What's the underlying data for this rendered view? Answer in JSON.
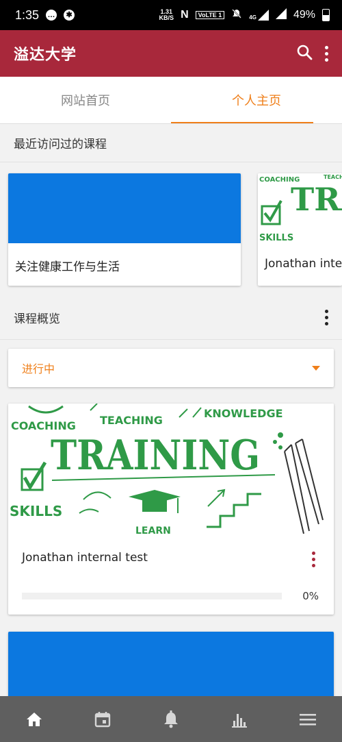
{
  "status": {
    "time": "1:35",
    "net_speed_value": "1.31",
    "net_speed_unit": "KB/S",
    "volte": "VoLTE 1",
    "network": "4G",
    "battery": "49%"
  },
  "app": {
    "title": "溢达大学"
  },
  "tabs": [
    {
      "label": "网站首页",
      "active": false
    },
    {
      "label": "个人主页",
      "active": true
    }
  ],
  "recent": {
    "title": "最近访问过的课程",
    "courses": [
      {
        "name": "关注健康工作与生活",
        "image": "blue"
      },
      {
        "name": "Jonathan internal test",
        "image": "training"
      }
    ]
  },
  "overview": {
    "title": "课程概览",
    "filter": "进行中",
    "course": {
      "name": "Jonathan internal test",
      "progress_text": "0%",
      "progress": 0
    },
    "image_words": {
      "coaching": "COACHING",
      "teaching": "TEACHING",
      "knowledge": "KNOWLEDGE",
      "training": "TRAINING",
      "skills": "SKILLS",
      "learn": "LEARN"
    }
  },
  "colors": {
    "brand": "#a8283b",
    "accent": "#ef7f1a",
    "blue": "#0c78e0",
    "art_green": "#2f9a47"
  },
  "nav": [
    "home-icon",
    "calendar-icon",
    "bell-icon",
    "bar-chart-icon",
    "menu-icon"
  ]
}
